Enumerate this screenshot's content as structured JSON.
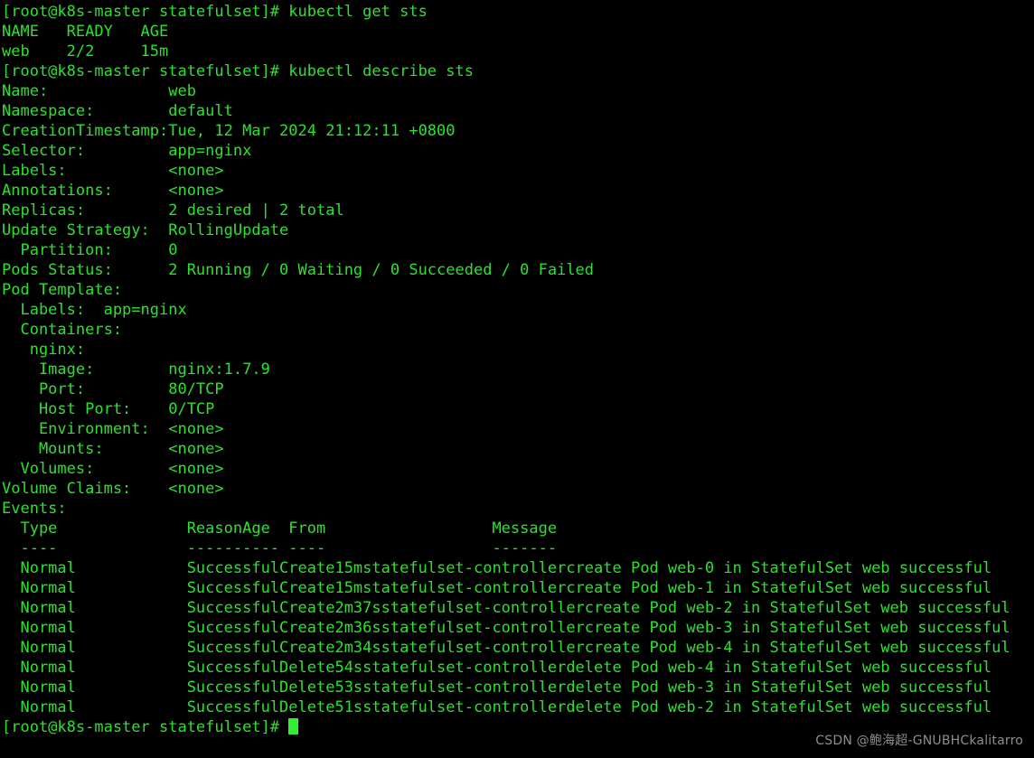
{
  "terminal": {
    "background_color": "#000000",
    "text_color": "#2ee02e",
    "cursor_color": "#33ee33",
    "prompt": "[root@k8s-master statefulset]#",
    "commands": [
      "kubectl get sts",
      "kubectl describe sts"
    ],
    "get_sts_output": {
      "header": "NAME   READY   AGE",
      "rows": [
        "web    2/2     15m"
      ]
    },
    "describe_fields": [
      {
        "key": "Name:",
        "value": "web"
      },
      {
        "key": "Namespace:",
        "value": "default"
      },
      {
        "key": "CreationTimestamp:",
        "value": "Tue, 12 Mar 2024 21:12:11 +0800"
      },
      {
        "key": "Selector:",
        "value": "app=nginx"
      },
      {
        "key": "Labels:",
        "value": "<none>"
      },
      {
        "key": "Annotations:",
        "value": "<none>"
      },
      {
        "key": "Replicas:",
        "value": "2 desired | 2 total"
      },
      {
        "key": "Update Strategy:",
        "value": "RollingUpdate"
      },
      {
        "key": "  Partition:",
        "value": "0"
      },
      {
        "key": "Pods Status:",
        "value": "2 Running / 0 Waiting / 0 Succeeded / 0 Failed"
      }
    ],
    "pod_template": {
      "heading": "Pod Template:",
      "labels_line": "  Labels:  app=nginx",
      "containers_line": "  Containers:",
      "container_name_line": "   nginx:",
      "container_fields": [
        {
          "key": "    Image:",
          "value": "nginx:1.7.9"
        },
        {
          "key": "    Port:",
          "value": "80/TCP"
        },
        {
          "key": "    Host Port:",
          "value": "0/TCP"
        },
        {
          "key": "    Environment:",
          "value": "<none>"
        },
        {
          "key": "    Mounts:",
          "value": "<none>"
        }
      ],
      "volumes_line": {
        "key": "  Volumes:",
        "value": "<none>"
      },
      "volume_claims_line": {
        "key": "Volume Claims:",
        "value": "<none>"
      }
    },
    "events": {
      "heading": "Events:",
      "columns": [
        "Type",
        "Reason",
        "Age",
        "From",
        "Message"
      ],
      "separators": [
        "----",
        "------",
        "----",
        "----",
        "-------"
      ],
      "rows": [
        {
          "type": "Normal",
          "reason": "SuccessfulCreate",
          "age": "15m",
          "from": "statefulset-controller",
          "message": "create Pod web-0 in StatefulSet web successful"
        },
        {
          "type": "Normal",
          "reason": "SuccessfulCreate",
          "age": "15m",
          "from": "statefulset-controller",
          "message": "create Pod web-1 in StatefulSet web successful"
        },
        {
          "type": "Normal",
          "reason": "SuccessfulCreate",
          "age": "2m37s",
          "from": "statefulset-controller",
          "message": "create Pod web-2 in StatefulSet web successful"
        },
        {
          "type": "Normal",
          "reason": "SuccessfulCreate",
          "age": "2m36s",
          "from": "statefulset-controller",
          "message": "create Pod web-3 in StatefulSet web successful"
        },
        {
          "type": "Normal",
          "reason": "SuccessfulCreate",
          "age": "2m34s",
          "from": "statefulset-controller",
          "message": "create Pod web-4 in StatefulSet web successful"
        },
        {
          "type": "Normal",
          "reason": "SuccessfulDelete",
          "age": "54s",
          "from": "statefulset-controller",
          "message": "delete Pod web-4 in StatefulSet web successful"
        },
        {
          "type": "Normal",
          "reason": "SuccessfulDelete",
          "age": "53s",
          "from": "statefulset-controller",
          "message": "delete Pod web-3 in StatefulSet web successful"
        },
        {
          "type": "Normal",
          "reason": "SuccessfulDelete",
          "age": "51s",
          "from": "statefulset-controller",
          "message": "delete Pod web-2 in StatefulSet web successful"
        }
      ]
    }
  },
  "watermark": {
    "text": "CSDN @鲍海超-GNUBHCkalitarro",
    "color": "#8d8d8d"
  }
}
